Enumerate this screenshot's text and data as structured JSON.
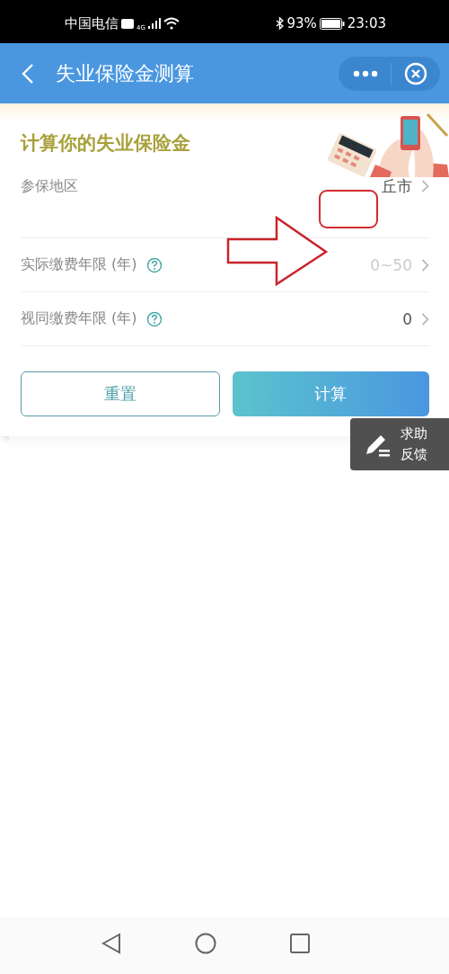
{
  "status_bar": {
    "carrier": "中国电信",
    "network": "4G",
    "battery": "93%",
    "time": "23:03"
  },
  "header": {
    "title": "失业保险金测算"
  },
  "card": {
    "title": "计算你的失业保险金"
  },
  "fields": [
    {
      "label": "参保地区",
      "value": "丘市",
      "help": false
    },
    {
      "label": "实际缴费年限 (年)",
      "placeholder": "0~50",
      "help": true
    },
    {
      "label": "视同缴费年限 (年)",
      "value": "0",
      "help": true
    }
  ],
  "buttons": [
    {
      "label": "重置",
      "kind": "outline"
    },
    {
      "label": "计算",
      "kind": "primary"
    }
  ],
  "feedback": {
    "line1": "求助",
    "line2": "反馈"
  },
  "annotations": {
    "arrow": true,
    "highlight_box": true
  }
}
